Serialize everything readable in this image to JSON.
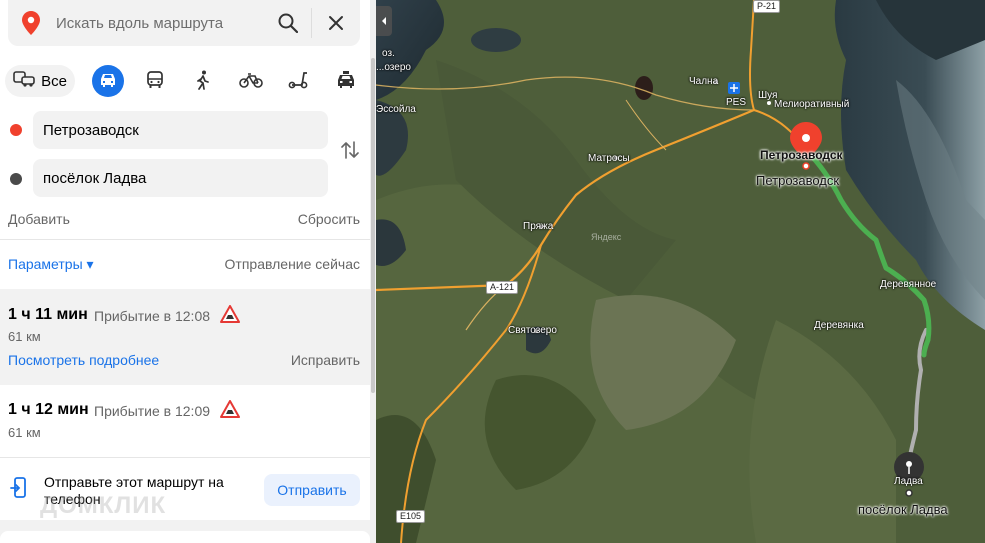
{
  "search": {
    "placeholder": "Искать вдоль маршрута"
  },
  "modes": {
    "all_label": "Все"
  },
  "points": {
    "from": "Петрозаводск",
    "to": "посёлок Ладва"
  },
  "actions": {
    "add": "Добавить",
    "reset": "Сбросить"
  },
  "options": {
    "params": "Параметры ▾",
    "departure": "Отправление сейчас"
  },
  "routes": [
    {
      "time": "1 ч 11 мин",
      "arrival": "Прибытие в 12:08",
      "distance": "61 км",
      "details": "Посмотреть подробнее",
      "fix": "Исправить"
    },
    {
      "time": "1 ч 12 мин",
      "arrival": "Прибытие в 12:09",
      "distance": "61 км"
    }
  ],
  "send": {
    "text": "Отправьте этот маршрут на телефон",
    "button": "Отправить"
  },
  "watermark": "ДОМКЛИК",
  "map": {
    "labels": {
      "oz": "оз.",
      "ozero": "...озеро",
      "essoila": "Эссойла",
      "chalna": "Чална",
      "shuya": "Шуя",
      "pes": "PES",
      "meliorativny": "Мелиоративный",
      "petrozavodsk": "Петрозаводск",
      "matrosy": "Матросы",
      "pryazha": "Пряжа",
      "svyatozero": "Святозеро",
      "derevyannoe": "Деревянное",
      "derevyanka": "Деревянка",
      "ladva": "Ладва",
      "yandex": "Яндекс"
    },
    "selected": {
      "from": "Петрозаводск",
      "to": "посёлок Ладва"
    },
    "roads": {
      "r21": "Р-21",
      "a121": "А-121",
      "e105": "Е105"
    },
    "colors": {
      "route_main": "#4caf50",
      "route_alt": "#b0b0b0",
      "roads": "#f0a030",
      "pin_from": "#f0412d",
      "pin_to": "#333333",
      "accent": "#1a73e8"
    }
  }
}
